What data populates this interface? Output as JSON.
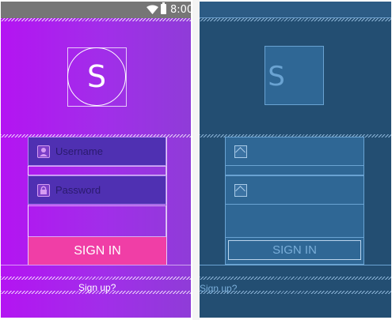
{
  "status_bar": {
    "time": "8:00",
    "wifi_icon": "wifi-icon",
    "battery_icon": "battery-icon"
  },
  "design_view": {
    "logo_letter": "S",
    "username": {
      "placeholder": "Username",
      "icon": "user-icon"
    },
    "password": {
      "placeholder": "Password",
      "icon": "lock-icon"
    },
    "signin_label": "SIGN IN",
    "signup_label": "Sign up?",
    "colors": {
      "gradient_start": "#b414f2",
      "gradient_end": "#8f3cd8",
      "field_bg": "#4f30b2",
      "button_bg": "#f03ea6",
      "statusbar_bg": "#767676"
    }
  },
  "blueprint_view": {
    "logo_letter": "S",
    "signin_label": "SIGN IN",
    "signup_label": "Sign up?",
    "field_icon": "image-placeholder-icon",
    "colors": {
      "background": "#234e72",
      "region": "#2f6795",
      "outline": "#6aa3d2"
    }
  }
}
